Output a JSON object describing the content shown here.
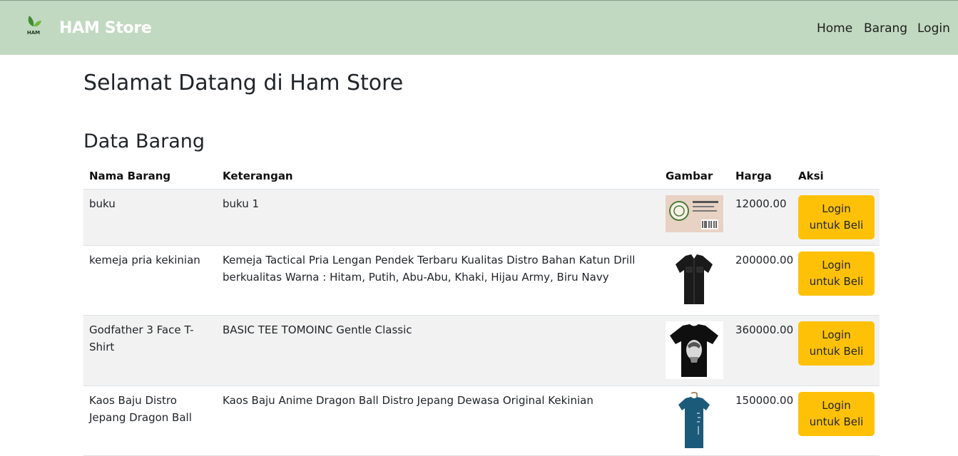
{
  "brand": {
    "name": "HAM Store",
    "logo_text": "HAM"
  },
  "nav": {
    "home": "Home",
    "barang": "Barang",
    "login": "Login"
  },
  "main": {
    "title": "Selamat Datang di Ham Store",
    "section_title": "Data Barang"
  },
  "table": {
    "headers": [
      "Nama Barang",
      "Keterangan",
      "Gambar",
      "Harga",
      "Aksi"
    ],
    "rows": [
      {
        "nama": "buku",
        "keterangan": "buku 1",
        "harga": "12000.00",
        "aksi": "Login untuk Beli",
        "image": "book-label-image"
      },
      {
        "nama": "kemeja pria kekinian",
        "keterangan": "Kemeja Tactical Pria Lengan Pendek Terbaru Kualitas Distro Bahan Katun Drill berkualitas Warna : Hitam, Putih, Abu-Abu, Khaki, Hijau Army, Biru Navy",
        "harga": "200000.00",
        "aksi": "Login untuk Beli",
        "image": "black-shirt-image"
      },
      {
        "nama": "Godfather 3 Face T-Shirt",
        "keterangan": "BASIC TEE TOMOINC Gentle Classic",
        "harga": "360000.00",
        "aksi": "Login untuk Beli",
        "image": "godfather-tshirt-image"
      },
      {
        "nama": "Kaos Baju Distro Jepang Dragon Ball",
        "keterangan": "Kaos Baju Anime Dragon Ball Distro Jepang Dewasa Original Kekinian",
        "harga": "150000.00",
        "aksi": "Login untuk Beli",
        "image": "blue-tshirt-image"
      }
    ]
  },
  "colors": {
    "navbar": "#c1d9c0",
    "button": "#ffc107",
    "stripe": "#f2f2f2"
  }
}
